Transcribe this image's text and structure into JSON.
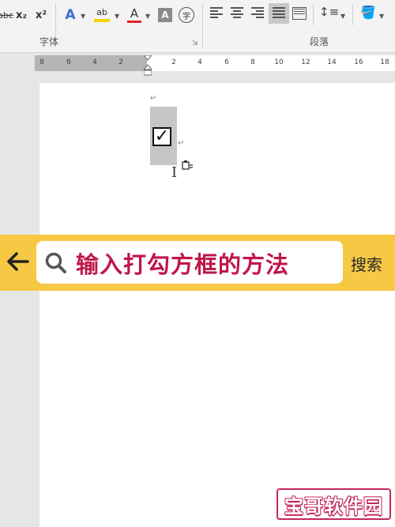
{
  "ribbon": {
    "font_group_label": "字体",
    "paragraph_group_label": "段落",
    "strike_label": "abc",
    "subscript_label": "x₂",
    "superscript_label": "x²",
    "text_effect_label": "A",
    "highlight_label": "ab",
    "font_color_label": "A",
    "char_shading_label": "A",
    "phonetic_label": "字",
    "highlight_color": "#f5d400",
    "font_color": "#e02020"
  },
  "ruler": {
    "labels": [
      "8",
      "6",
      "4",
      "2",
      "2",
      "4",
      "6",
      "8",
      "10",
      "12",
      "14",
      "16",
      "18"
    ]
  },
  "document": {
    "paragraph_mark": "↵",
    "checkbox_glyph": "✓",
    "cursor_glyph": "I",
    "paste_options_icon": "paste-options-icon"
  },
  "search": {
    "query": "输入打勾方框的方法",
    "button_label": "搜索",
    "back_icon": "arrow-left-icon",
    "search_icon": "search-icon",
    "bar_color": "#f6c843",
    "query_color": "#c0164a"
  },
  "watermark": {
    "text": "宝哥软件园"
  }
}
